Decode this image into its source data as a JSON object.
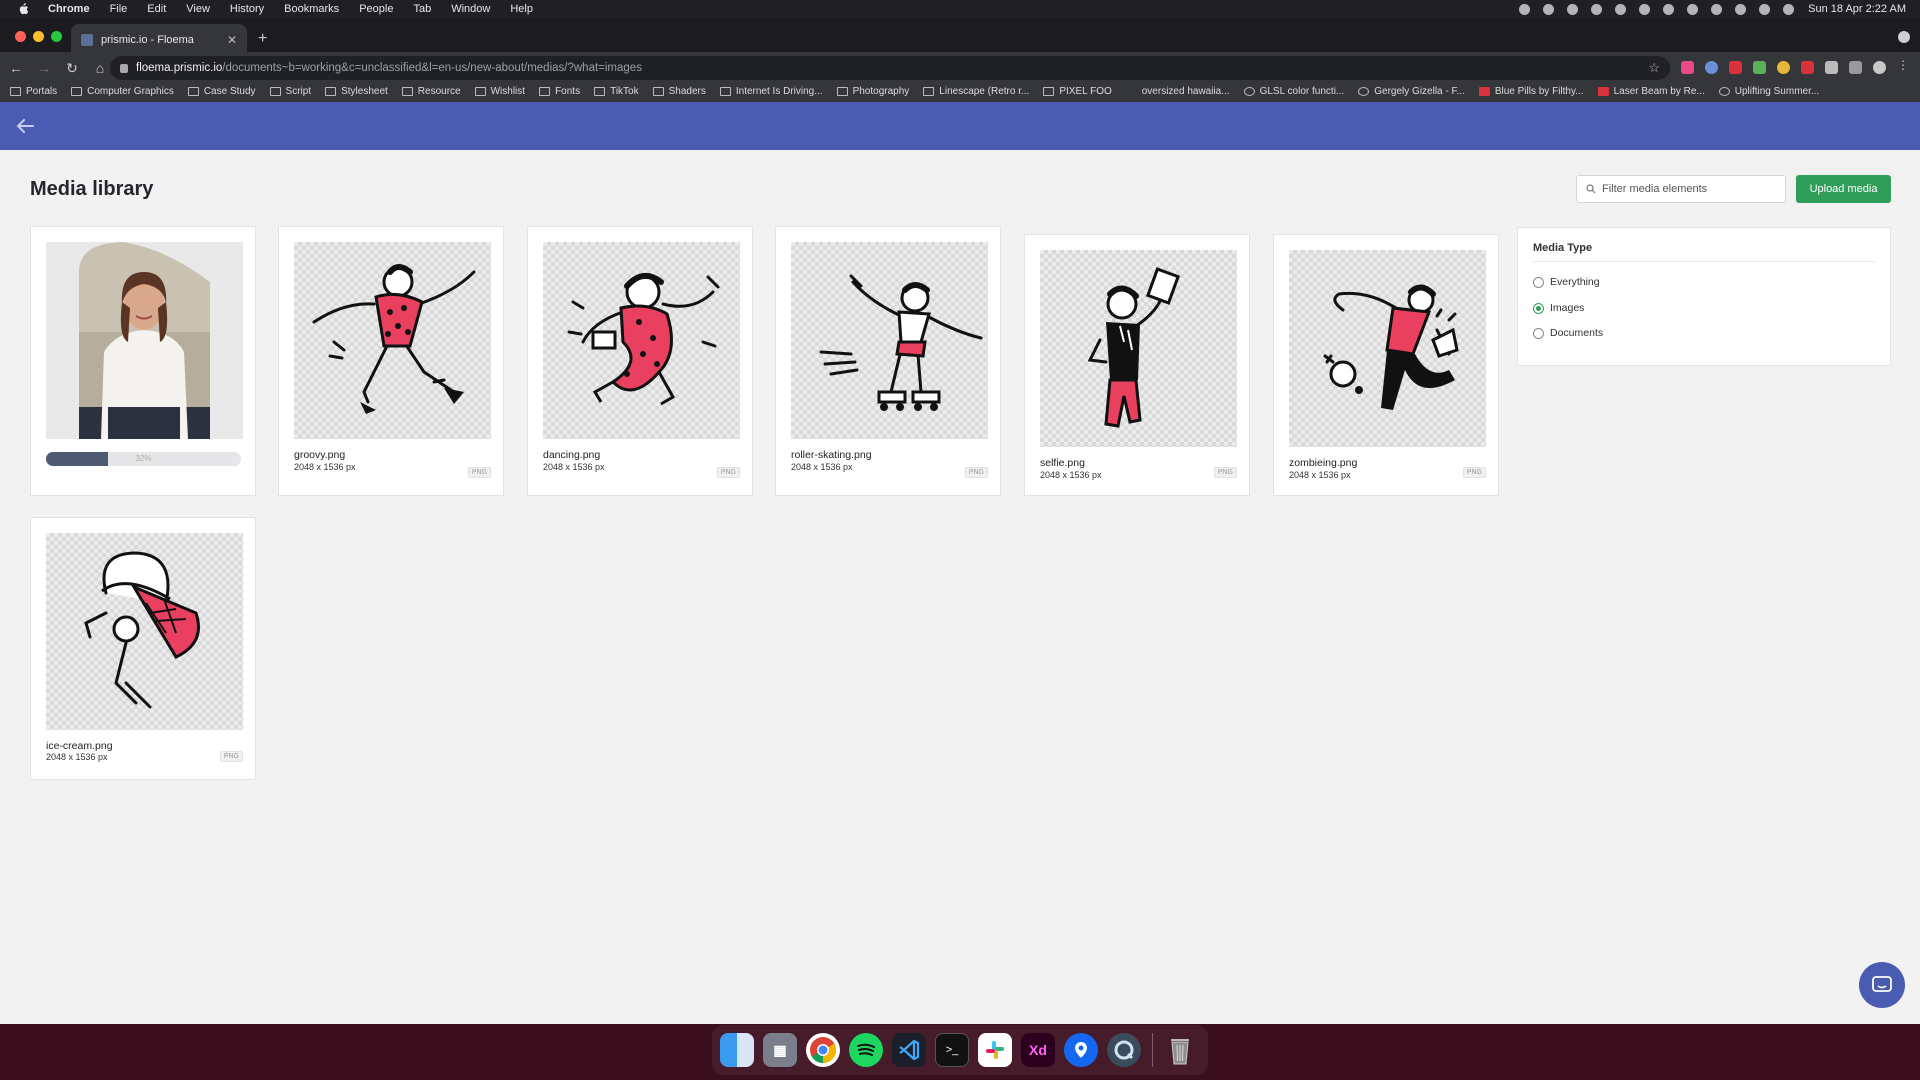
{
  "menubar": {
    "app_name": "Chrome",
    "items": [
      "File",
      "Edit",
      "View",
      "History",
      "Bookmarks",
      "People",
      "Tab",
      "Window",
      "Help"
    ],
    "clock": "Sun 18 Apr  2:22 AM"
  },
  "browser": {
    "tab_title": "prismic.io - Floema",
    "url_host": "floema.prismic.io",
    "url_path": "/documents~b=working&c=unclassified&l=en-us/new-about/medias/?what=images",
    "bookmarks": [
      "Portals",
      "Computer Graphics",
      "Case Study",
      "Script",
      "Stylesheet",
      "Resource",
      "Wishlist",
      "Fonts",
      "TikTok",
      "Shaders",
      "Internet Is Driving...",
      "Photography",
      "Linescape (Retro r...",
      "PIXEL FOO",
      "oversized hawaiia...",
      "GLSL color functi...",
      "Gergely Gizella - F...",
      "Blue Pills by Filthy...",
      "Laser Beam by Re...",
      "Uplifting Summer..."
    ]
  },
  "page": {
    "title": "Media library",
    "filter_placeholder": "Filter media elements",
    "upload_label": "Upload media"
  },
  "uploading": {
    "progress": 0.32,
    "progress_label": "32%"
  },
  "media": [
    {
      "name": "groovy.png",
      "size": "2048 x 1536 px",
      "type": "PNG"
    },
    {
      "name": "dancing.png",
      "size": "2048 x 1536 px",
      "type": "PNG"
    },
    {
      "name": "roller-skating.png",
      "size": "2048 x 1536 px",
      "type": "PNG"
    },
    {
      "name": "selfie.png",
      "size": "2048 x 1536 px",
      "type": "PNG"
    },
    {
      "name": "zombieing.png",
      "size": "2048 x 1536 px",
      "type": "PNG"
    },
    {
      "name": "ice-cream.png",
      "size": "2048 x 1536 px",
      "type": "PNG"
    }
  ],
  "filters": {
    "title": "Media Type",
    "options": [
      "Everything",
      "Images",
      "Documents"
    ],
    "selected": "Images"
  },
  "colors": {
    "header": "#4a5cb2",
    "accent": "#2f9e59",
    "illustration_red": "#e8405e"
  },
  "dock": {
    "apps": [
      "finder-icon",
      "launchpad-icon",
      "chrome-icon",
      "spotify-icon",
      "vscode-icon",
      "terminal-icon",
      "slack-icon",
      "xd-icon",
      "maps-pin-icon",
      "quicktime-icon",
      "trash-icon"
    ],
    "xd_label": "Xd"
  }
}
